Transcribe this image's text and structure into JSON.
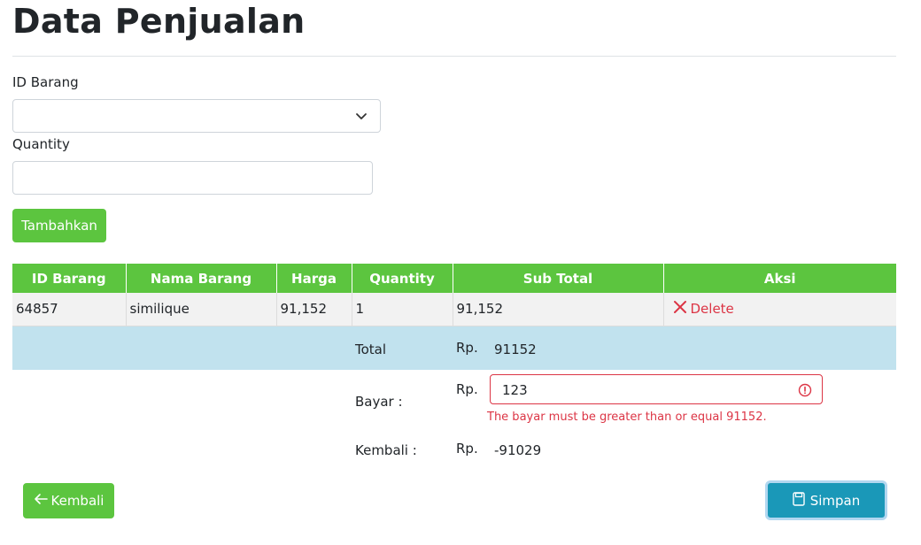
{
  "page": {
    "title": "Data Penjualan"
  },
  "form": {
    "id_barang_label": "ID Barang",
    "id_barang_value": "",
    "quantity_label": "Quantity",
    "quantity_value": "",
    "add_button": "Tambahkan"
  },
  "table": {
    "headers": [
      "ID Barang",
      "Nama Barang",
      "Harga",
      "Quantity",
      "Sub Total",
      "Aksi"
    ],
    "rows": [
      {
        "id": "64857",
        "name": "similique",
        "price": "91,152",
        "qty": "1",
        "subtotal": "91,152",
        "action": "Delete"
      }
    ]
  },
  "summary": {
    "total_label": "Total",
    "currency": "Rp.",
    "total_value": "91152",
    "bayar_label": "Bayar :",
    "bayar_value": "123",
    "bayar_error": "The bayar must be greater than or equal 91152.",
    "kembali_label": "Kembali :",
    "kembali_value": "-91029"
  },
  "actions": {
    "back": "Kembali",
    "save": "Simpan"
  },
  "colors": {
    "green": "#5cc53f",
    "danger": "#dc3545",
    "info": "#1a98b8",
    "total_row": "#c1e2ee"
  }
}
